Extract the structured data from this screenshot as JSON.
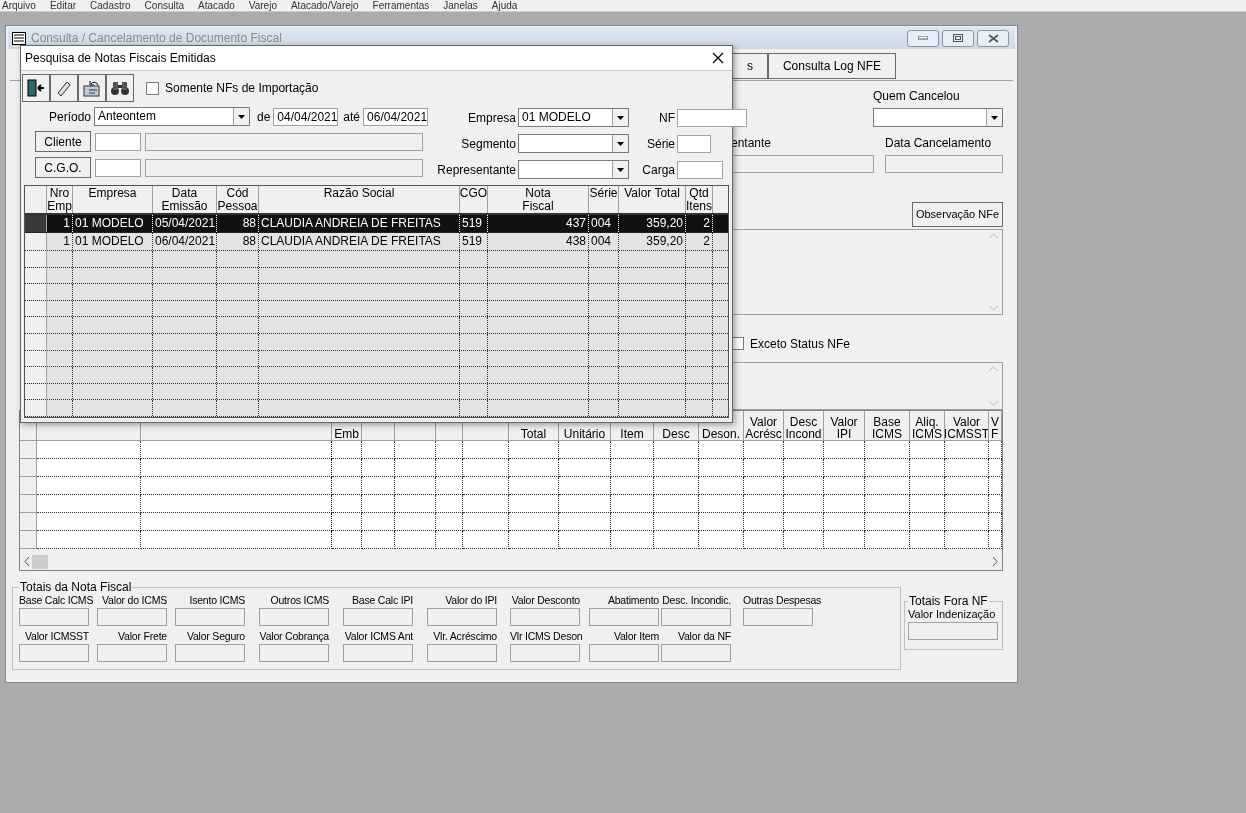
{
  "menu": [
    {
      "label": "Arquivo"
    },
    {
      "label": "Editar"
    },
    {
      "label": "Cadastro"
    },
    {
      "label": "Consulta"
    },
    {
      "label": "Atacado"
    },
    {
      "label": "Varejo"
    },
    {
      "label": "Atacado/Varejo"
    },
    {
      "label": "Ferramentas"
    },
    {
      "label": "Janelas"
    },
    {
      "label": "Ajuda"
    }
  ],
  "main_window": {
    "title": "Consulta / Cancelamento de Documento Fiscal",
    "tabs": [
      {
        "label": "s",
        "selected": false
      },
      {
        "label": "Consulta Log NFE",
        "selected": false
      }
    ],
    "quem_cancelou": {
      "label": "Quem Cancelou"
    },
    "representante": {
      "label": "entante"
    },
    "data_cancelamento": {
      "label": "Data Cancelamento"
    },
    "observacao_button": "Observação NFe",
    "exceto_status": {
      "label": "Exceto Status NFe",
      "checked": false
    },
    "items_grid": {
      "columns": [
        {},
        {},
        {
          "lines": [
            "Emb"
          ]
        },
        {},
        {},
        {},
        {},
        {
          "lines": [
            "Total"
          ]
        },
        {
          "lines": [
            "Unitário"
          ]
        },
        {
          "lines": [
            "Item"
          ]
        },
        {
          "lines": [
            "Desc"
          ]
        },
        {
          "lines": [
            "Deson."
          ]
        },
        {
          "lines": [
            "Valor",
            "Acrésc"
          ]
        },
        {
          "lines": [
            "Desc",
            "Incond"
          ]
        },
        {
          "lines": [
            "Valor",
            "IPI"
          ]
        },
        {
          "lines": [
            "Base",
            "ICMS"
          ]
        },
        {
          "lines": [
            "Aliq.",
            "ICMS"
          ]
        },
        {
          "lines": [
            "Valor",
            "ICMSST"
          ]
        },
        {
          "lines": [
            "V",
            "F"
          ]
        }
      ]
    },
    "totais_nf": {
      "title": "Totais da Nota Fiscal",
      "rows": [
        [
          "Base Calc ICMS",
          "Valor do ICMS",
          "Isento ICMS",
          "Outros ICMS",
          "Base Calc IPI",
          "Valor do IPI",
          "Valor Desconto",
          "Abatimento",
          "Desc. Incondic.",
          "Outras Despesas"
        ],
        [
          "Valor ICMSST",
          "Valor Frete",
          "Valor Seguro",
          "Valor Cobrança",
          "Valor ICMS Ant",
          "Vlr. Acréscimo",
          "Vlr ICMS Deson",
          "Valor Item",
          "Valor da NF"
        ]
      ]
    },
    "totais_fora_nf": {
      "title": "Totais Fora NF",
      "fields": [
        "Valor Indenização"
      ]
    }
  },
  "dialog": {
    "title": "Pesquisa de Notas Fiscais Emitidas",
    "somente_importacao": {
      "label": "Somente NFs de Importação",
      "checked": false
    },
    "periodo": {
      "label": "Período",
      "value": "Anteontem"
    },
    "de": {
      "label": "de",
      "value": "04/04/2021"
    },
    "ate": {
      "label": "até",
      "value": "06/04/2021"
    },
    "empresa": {
      "label": "Empresa",
      "value": "01 MODELO"
    },
    "nf": {
      "label": "NF"
    },
    "cliente_button": "Cliente",
    "segmento": {
      "label": "Segmento"
    },
    "serie": {
      "label": "Série"
    },
    "cgo_button": "C.G.O.",
    "representante": {
      "label": "Representante"
    },
    "carga": {
      "label": "Carga"
    },
    "grid": {
      "columns": [
        {
          "lines": [
            "Nro",
            "Emp"
          ]
        },
        {
          "lines": [
            "Empresa"
          ]
        },
        {
          "lines": [
            "Data",
            "Emissão"
          ]
        },
        {
          "lines": [
            "Cód",
            "Pessoa"
          ]
        },
        {
          "lines": [
            "Razão Social"
          ]
        },
        {
          "lines": [
            "CGO"
          ]
        },
        {
          "lines": [
            "Nota",
            "Fiscal"
          ]
        },
        {
          "lines": [
            "Série"
          ]
        },
        {
          "lines": [
            "Valor Total"
          ]
        },
        {
          "lines": [
            "Qtd",
            "Itens"
          ]
        }
      ],
      "rows": [
        {
          "selected": true,
          "cells": [
            "1",
            "01 MODELO",
            "05/04/2021",
            "88",
            "CLAUDIA ANDREIA DE FREITAS",
            "519",
            "437",
            "004",
            "359,20",
            "2"
          ]
        },
        {
          "selected": false,
          "cells": [
            "1",
            "01 MODELO",
            "06/04/2021",
            "88",
            "CLAUDIA ANDREIA DE FREITAS",
            "519",
            "438",
            "004",
            "359,20",
            "2"
          ]
        }
      ]
    }
  }
}
